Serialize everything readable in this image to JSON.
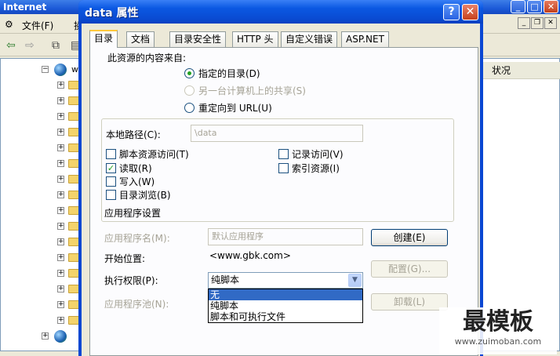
{
  "background_window": {
    "title": "Internet",
    "menu": [
      "文件(F)",
      "操"
    ],
    "column_header": "状况",
    "tree_root_label": "w"
  },
  "dialog": {
    "title": "data 属性",
    "help_glyph": "?",
    "close_glyph": "✕",
    "tabs": [
      "目录",
      "文档",
      "目录安全性",
      "HTTP 头",
      "自定义错误",
      "ASP.NET"
    ],
    "source_heading": "此资源的内容来自:",
    "source_options": [
      {
        "label": "指定的目录(D)",
        "checked": true,
        "enabled": true
      },
      {
        "label": "另一台计算机上的共享(S)",
        "checked": false,
        "enabled": false
      },
      {
        "label": "重定向到 URL(U)",
        "checked": false,
        "enabled": true
      }
    ],
    "local_path_label": "本地路径(C):",
    "local_path_value": "\\data",
    "permissions": [
      {
        "label": "脚本资源访问(T)",
        "checked": false
      },
      {
        "label": "读取(R)",
        "checked": true
      },
      {
        "label": "写入(W)",
        "checked": false
      },
      {
        "label": "目录浏览(B)",
        "checked": false
      },
      {
        "label": "记录访问(V)",
        "checked": false
      },
      {
        "label": "索引资源(I)",
        "checked": false
      }
    ],
    "app_settings_heading": "应用程序设置",
    "app_name_label": "应用程序名(M):",
    "app_name_value": "默认应用程序",
    "create_button": "创建(E)",
    "start_point_label": "开始位置:",
    "start_point_value": "<www.gbk.com>",
    "config_button": "配置(G)...",
    "exec_perm_label": "执行权限(P):",
    "exec_perm_value": "纯脚本",
    "exec_perm_options": [
      "无",
      "纯脚本",
      "脚本和可执行文件"
    ],
    "exec_perm_highlighted": "无",
    "app_pool_label": "应用程序池(N):",
    "unload_button": "卸载(L)"
  },
  "watermark": {
    "main": "最模板",
    "sub": "www.zuimoban.com"
  },
  "colors": {
    "xp_titlebar": "#0a4bd2",
    "dialog_face": "#ece9d8",
    "selection": "#316ac5",
    "check_green": "#21a121"
  }
}
